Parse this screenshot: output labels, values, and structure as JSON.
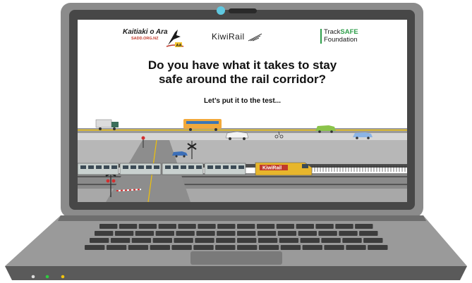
{
  "logos": {
    "kaitiaki_title": "Kaitiaki o Ara",
    "kaitiaki_url": "SADD.ORG.NZ",
    "kaitiaki_badge": "AA",
    "kiwirail": "KiwiRail",
    "tracksafe_line1_prefix": "Track",
    "tracksafe_line1_accent": "SAFE",
    "tracksafe_line2": "Foundation"
  },
  "headline": {
    "line1": "Do you have what it takes to stay",
    "line2": "safe around the rail corridor?"
  },
  "subhead": "Let’s put it to the test...",
  "train_brand": "KiwiRail",
  "colors": {
    "laptop_body": "#8a8a8a",
    "laptop_dark": "#3a3a3a",
    "bezel": "#4a4a4a",
    "camera": "#5fc8e0",
    "road": "#9a9a9a",
    "road_line": "#f0c20a",
    "track": "#6a6a6a",
    "train_car": "#c9d1cf",
    "locomotive": "#e7b62c",
    "grass": "#4d4d4d",
    "led_green": "#2ecc40",
    "led_yellow": "#f1c40f"
  }
}
